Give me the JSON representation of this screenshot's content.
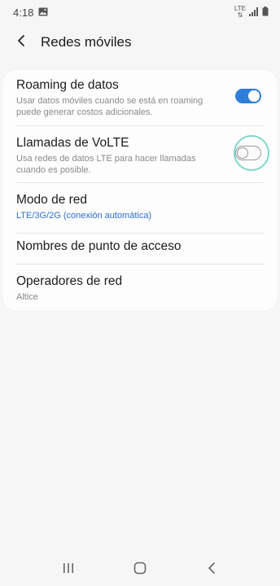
{
  "status_bar": {
    "time": "4:18",
    "network_type": "LTE",
    "icons": [
      "gallery-icon",
      "lte-icon",
      "signal-icon",
      "battery-icon"
    ]
  },
  "header": {
    "title": "Redes móviles",
    "back_icon": "chevron-left-icon"
  },
  "settings": {
    "roaming": {
      "title": "Roaming de datos",
      "subtitle": "Usar datos móviles cuando se está en roaming puede generar costos adicionales.",
      "toggle_state": true
    },
    "volte": {
      "title": "Llamadas de VoLTE",
      "subtitle": "Usa redes de datos LTE para hacer llamadas cuando es posible.",
      "toggle_state": false
    },
    "network_mode": {
      "title": "Modo de red",
      "subtitle": "LTE/3G/2G (conexión automática)"
    },
    "apn": {
      "title": "Nombres de punto de acceso"
    },
    "operators": {
      "title": "Operadores de red",
      "subtitle": "Altice"
    }
  },
  "nav_bar": {
    "icons": [
      "recents-icon",
      "home-icon",
      "back-icon"
    ]
  },
  "colors": {
    "accent": "#2f7ed8",
    "highlight_ring": "#7ed8c9",
    "link_blue": "#2c6fd3",
    "background": "#f6f6f6"
  }
}
